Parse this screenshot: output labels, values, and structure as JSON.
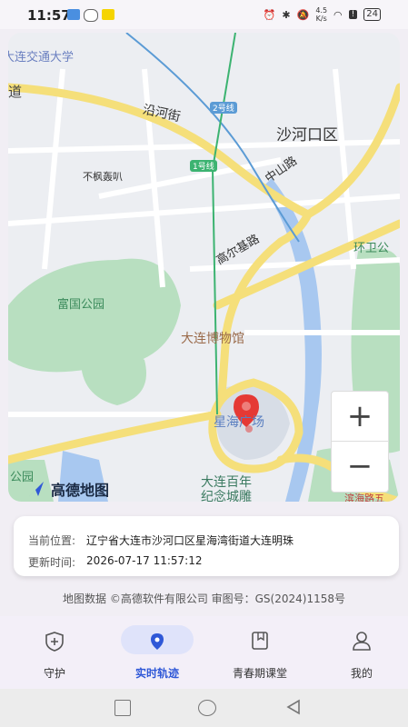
{
  "status_bar": {
    "time": "11:57",
    "net_speed_top": "4.5",
    "net_speed_bottom": "K/s",
    "battery": "24"
  },
  "map": {
    "labels": {
      "university": "大连交通大学",
      "road_left": "道",
      "yanhe": "沿河街",
      "line2": "2号线",
      "district": "沙河口区",
      "zhongshan": "中山路",
      "bufeng": "不枫轰叭",
      "line1": "1号线",
      "gaoerji": "高尔基路",
      "huanwei": "环卫公",
      "fuguo": "富国公园",
      "museum": "大连博物馆",
      "xinghai": "星海广场",
      "park_left": "公园",
      "centennial_1": "大连百年",
      "centennial_2": "纪念城雕",
      "bottom_right": "滨海路五"
    },
    "logo_text": "高德地图",
    "zoom_in": "+",
    "zoom_out": "−"
  },
  "info_card": {
    "location_label": "当前位置:",
    "location_value": "辽宁省大连市沙河口区星海湾街道大连明珠",
    "time_label": "更新时间:",
    "time_value": "2026-07-17 11:57:12"
  },
  "copyright": "地图数据 ©高德软件有限公司 审图号：GS(2024)1158号",
  "tabs": [
    {
      "label": "守护",
      "icon": "shield-icon"
    },
    {
      "label": "实时轨迹",
      "icon": "location-pin-icon"
    },
    {
      "label": "青春期课堂",
      "icon": "book-icon"
    },
    {
      "label": "我的",
      "icon": "person-icon"
    }
  ],
  "colors": {
    "accent": "#2f58d7",
    "park": "#b8dfc0",
    "water": "#a8c8f0",
    "road": "#f5df7a",
    "marker": "#e53935"
  }
}
